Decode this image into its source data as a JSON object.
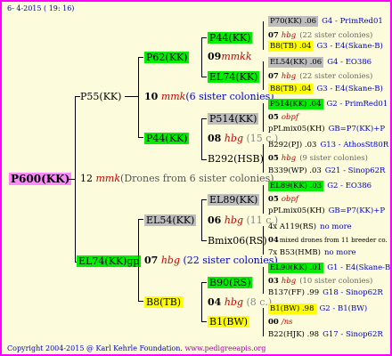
{
  "header": {
    "date": "6- 4-2015 ( 19: 16)"
  },
  "footer": {
    "copyright": "Copyright 2004-2015 @ Karl Kehrle Foundation.",
    "url": "www.pedigreeapis.org"
  },
  "root": {
    "label": "P600(KK)"
  },
  "gen1": {
    "top": {
      "label": "P55(KK)"
    },
    "mid_num": "12",
    "mid_code": "mmk",
    "mid_note": "(Drones from 6 sister colonies)",
    "bottom": {
      "label": "EL74(KK)gp"
    }
  },
  "gen2": {
    "a_num": "10",
    "a_code": "mmk",
    "a_note": "(6 sister colonies)",
    "p62": "P62(KK)",
    "p44": "P44(KK)",
    "b_num": "07",
    "b_code": "hbg",
    "b_note": "(22 sister colonies)",
    "el54": "EL54(KK)",
    "b8": "B8(TB)"
  },
  "gen3": {
    "p44kk": "P44(KK)",
    "num09": "09",
    "code09": "mmkk",
    "el74kk": "EL74(KK)",
    "p514": "P514(KK)",
    "num08": "08",
    "code08": "hbg",
    "note08": "(15 c.)",
    "b292hsb": "B292(HSB)",
    "el89": "EL89(KK)",
    "num06": "06",
    "code06": "hbg",
    "note06": "(11 c.)",
    "bmix06": "Bmix06(RS)",
    "b90": "B90(RS)",
    "num04": "04",
    "code04": "hbg",
    "note04": "(8 c.)",
    "b1bw": "B1(BW)"
  },
  "gen4": [
    {
      "label": "P70(KK) .06",
      "extra": "G4 - PrimRed01",
      "style": "gry"
    },
    {
      "label": "07",
      "code": "hbg",
      "extra": "(22 sister colonies)",
      "style": ""
    },
    {
      "label": "B8(TB) .04",
      "extra": "G3 - E4(Skane-B)",
      "style": "yel"
    },
    {
      "label": "EL54(KK) .06",
      "extra": "G4 - EO386",
      "style": "gry"
    },
    {
      "label": "07",
      "code": "hbg",
      "extra": "(22 sister colonies)",
      "style": ""
    },
    {
      "label": "B8(TB) .04",
      "extra": "G3 - E4(Skane-B)",
      "style": "yel"
    },
    {
      "label": "P514(KK) .04",
      "extra": "G2 - PrimRed01",
      "style": "grn"
    },
    {
      "label": "05",
      "code": "obpf",
      "extra": "",
      "style": ""
    },
    {
      "label": "pPLmix05(KH)",
      "extra": "GB=P7(KK)+P",
      "style": ""
    },
    {
      "label": "B292(PJ) .03",
      "extra": "G13 - AthosSt80R",
      "style": ""
    },
    {
      "label": "05",
      "code": "hbg",
      "extra": "(9 sister colonies)",
      "style": ""
    },
    {
      "label": "B339(WP) .03",
      "extra": "G21 - Sinop62R",
      "style": ""
    },
    {
      "label": "EL89(KK) .03",
      "extra": "G2 - EO386",
      "style": "grn"
    },
    {
      "label": "05",
      "code": "obpf",
      "extra": "",
      "style": ""
    },
    {
      "label": "pPLmix05(KH)",
      "extra": "GB=P7(KK)+P",
      "style": ""
    },
    {
      "label": "4x A119(RS)",
      "extra": "no more",
      "style": ""
    },
    {
      "label": "04",
      "code": "",
      "extra": "mixed drones from 11 breeder co.",
      "style": ""
    },
    {
      "label": "7x B53(HMB)",
      "extra": "no more",
      "style": ""
    },
    {
      "label": "EL90(KK) .01",
      "extra": "G1 - E4(Skane-B)",
      "style": "grn"
    },
    {
      "label": "03",
      "code": "hbg",
      "extra": "(10 sister colonies)",
      "style": ""
    },
    {
      "label": "B137(FF) .99",
      "extra": "G18 - Sinop62R",
      "style": ""
    },
    {
      "label": "B1(BW) .98",
      "extra": "G2 - B1(BW)",
      "style": "yel"
    },
    {
      "label": "00",
      "code": "/ns",
      "extra": "",
      "style": ""
    },
    {
      "label": "B22(HJK) .98",
      "extra": "G17 - Sinop62R",
      "style": ""
    }
  ]
}
